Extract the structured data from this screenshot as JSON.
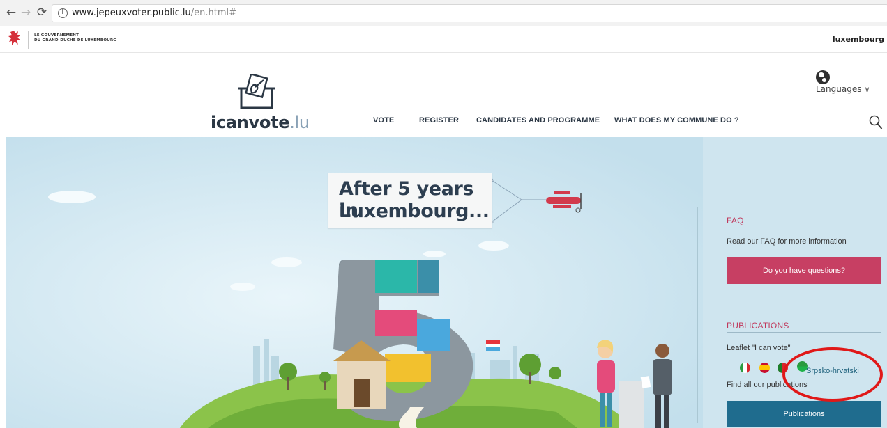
{
  "browser": {
    "back_icon": "back-arrow-icon",
    "forward_icon": "forward-arrow-icon",
    "reload_icon": "reload-icon",
    "url_host": "www.jepeuxvoter.public.lu",
    "url_path": "/en.html#"
  },
  "gov_banner": {
    "line1": "LE GOUVERNEMENT",
    "line2": "DU GRAND-DUCHÉ DE LUXEMBOURG",
    "right_label": "luxembourg"
  },
  "header": {
    "languages_label": "Languages",
    "logo_name": "icanvote",
    "logo_tld": ".lu",
    "nav": [
      {
        "label": "VOTE"
      },
      {
        "label": "REGISTER"
      },
      {
        "label": "CANDIDATES AND PROGRAMME"
      },
      {
        "label": "WHAT DOES MY COMMUNE DO ?"
      }
    ]
  },
  "hero": {
    "headline_line1": "After 5 years in",
    "headline_line2": "Luxembourg..."
  },
  "sidebar": {
    "faq": {
      "title": "FAQ",
      "text": "Read our FAQ for more information",
      "button": "Do you have questions?"
    },
    "publications": {
      "title": "PUBLICATIONS",
      "leaflet_text": "Leaflet \"I can vote\"",
      "language_link": "Srpsko-hrvatski",
      "find_text": "Find all our publications",
      "button": "Publications"
    }
  },
  "colors": {
    "accent_pink": "#c73f63",
    "accent_blue": "#1f6c8e",
    "sky": "#cfe5ef",
    "annotation_red": "#e01818"
  }
}
